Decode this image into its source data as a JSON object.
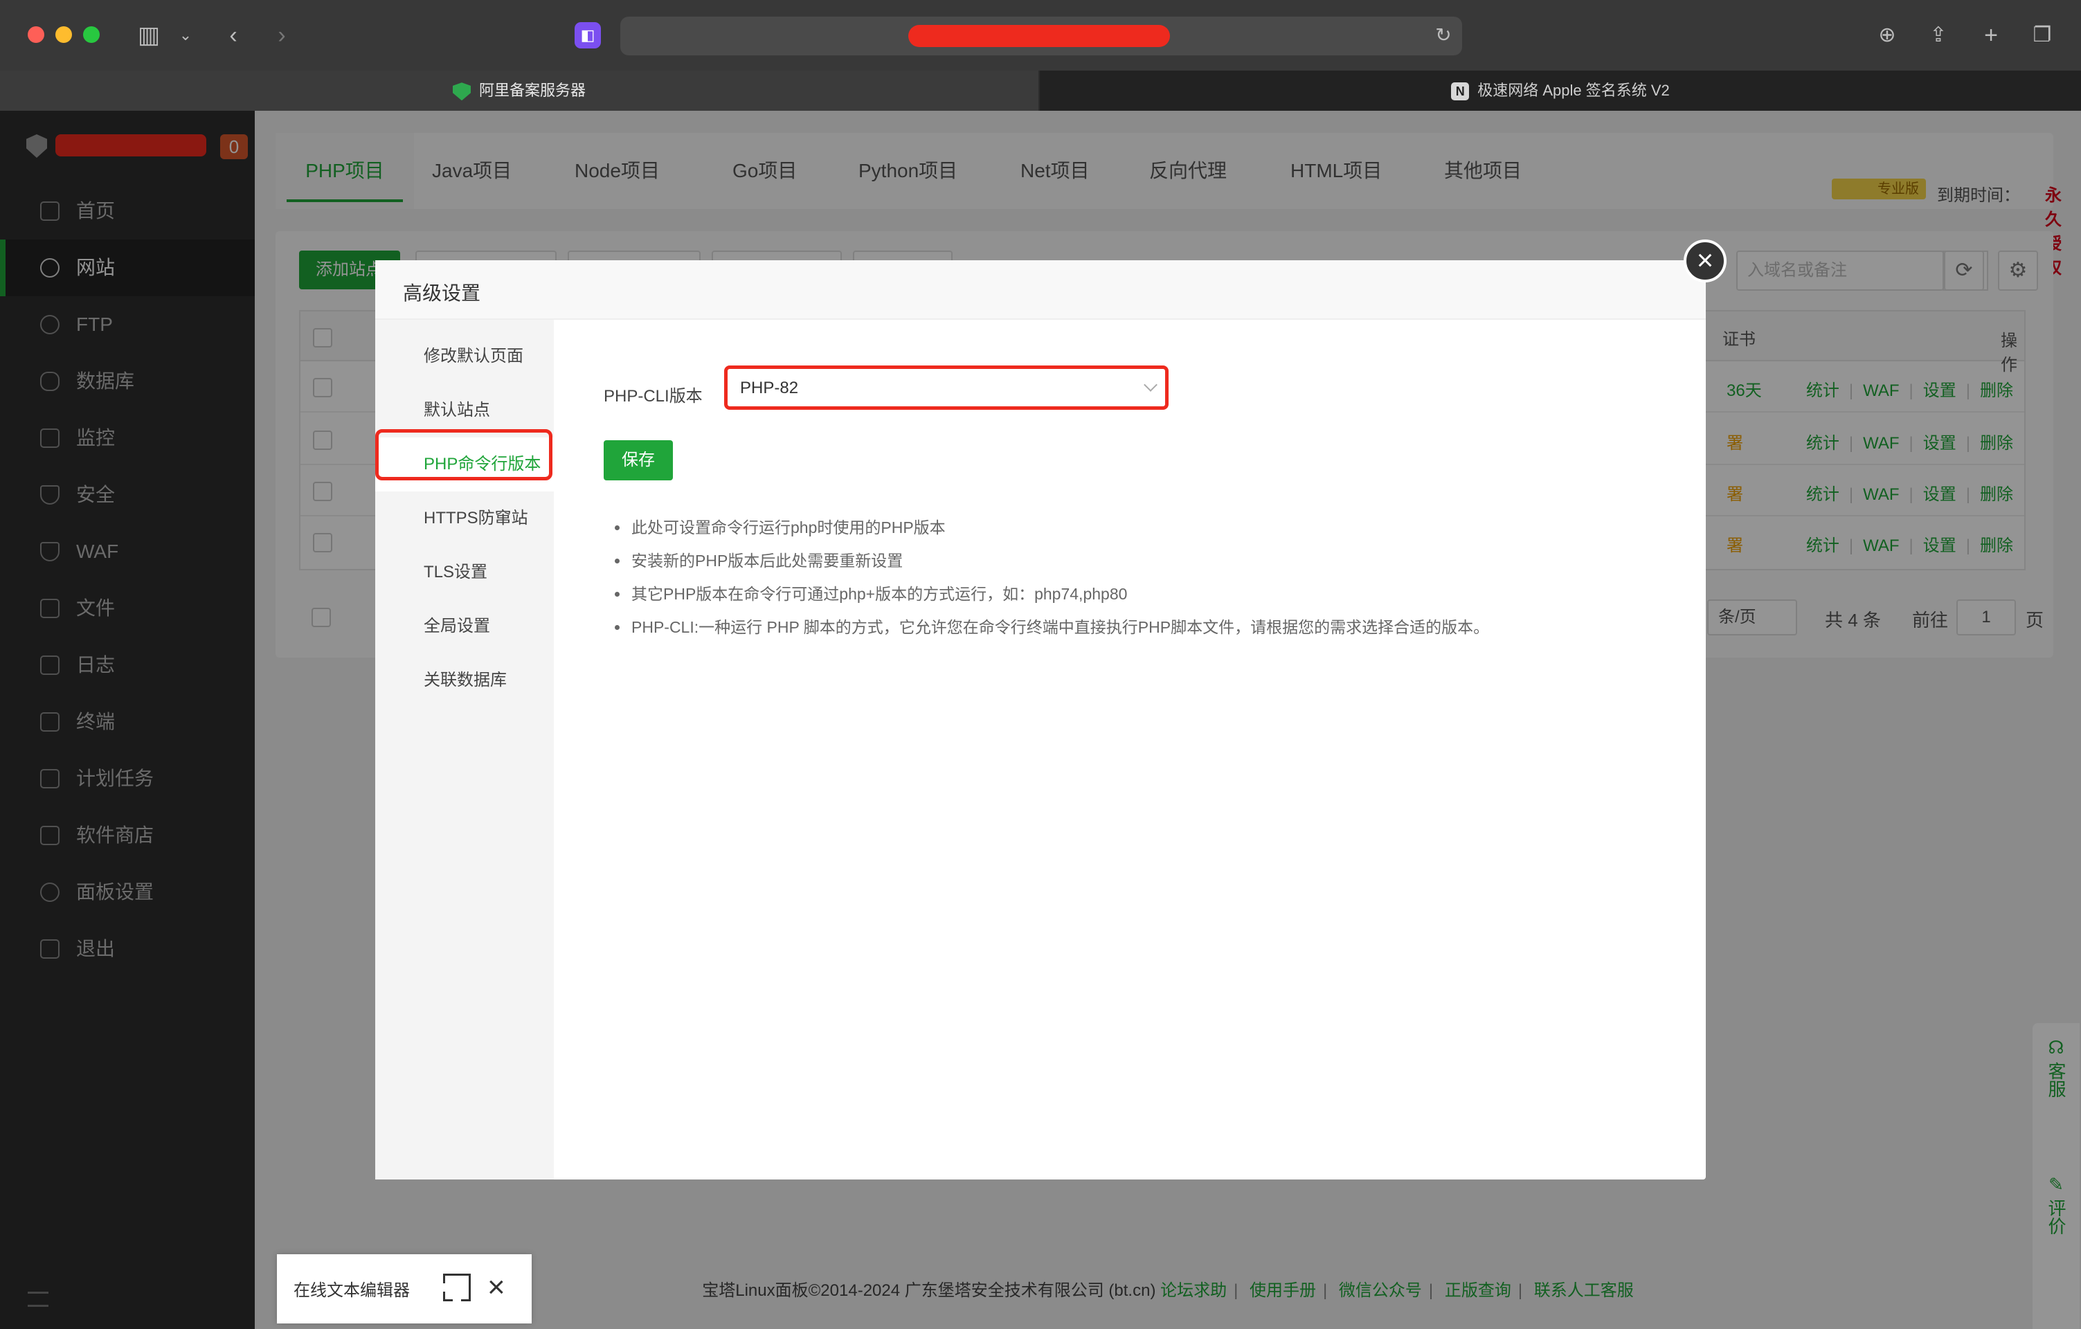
{
  "browser": {
    "tabs": [
      {
        "title": "阿里备案服务器",
        "active": true
      },
      {
        "title": "极速网络 Apple 签名系统 V2",
        "active": false,
        "favicon": "N"
      }
    ]
  },
  "sidebar": {
    "badge": "0",
    "items": [
      {
        "label": "首页",
        "icon": "home-icon"
      },
      {
        "label": "网站",
        "icon": "globe-icon",
        "active": true
      },
      {
        "label": "FTP",
        "icon": "ftp-icon"
      },
      {
        "label": "数据库",
        "icon": "database-icon"
      },
      {
        "label": "监控",
        "icon": "monitor-icon"
      },
      {
        "label": "安全",
        "icon": "shield-icon"
      },
      {
        "label": "WAF",
        "icon": "waf-icon"
      },
      {
        "label": "文件",
        "icon": "folder-icon"
      },
      {
        "label": "日志",
        "icon": "log-icon"
      },
      {
        "label": "终端",
        "icon": "terminal-icon"
      },
      {
        "label": "计划任务",
        "icon": "calendar-icon"
      },
      {
        "label": "软件商店",
        "icon": "apps-icon"
      },
      {
        "label": "面板设置",
        "icon": "gear-icon"
      },
      {
        "label": "退出",
        "icon": "logout-icon"
      }
    ]
  },
  "project_tabs": [
    "PHP项目",
    "Java项目",
    "Node项目",
    "Go项目",
    "Python项目",
    "Net项目",
    "反向代理",
    "HTML项目",
    "其他项目"
  ],
  "license": {
    "badge": "专业版",
    "expire_label": "到期时间：",
    "expire_value": "永久授权"
  },
  "toolbar": {
    "add_site": "添加站点",
    "search_placeholder": "入域名或备注"
  },
  "table": {
    "header_cert": "证书",
    "header_ops": "操作",
    "rows": [
      {
        "cert": "36天",
        "ops": [
          "统计",
          "WAF",
          "设置",
          "删除"
        ]
      },
      {
        "cert": "署",
        "ops": [
          "统计",
          "WAF",
          "设置",
          "删除"
        ]
      },
      {
        "cert": "署",
        "ops": [
          "统计",
          "WAF",
          "设置",
          "删除"
        ]
      },
      {
        "cert": "署",
        "ops": [
          "统计",
          "WAF",
          "设置",
          "删除"
        ]
      }
    ]
  },
  "pager": {
    "per_page": "条/页",
    "total": "共 4 条",
    "goto": "前往",
    "page": "1",
    "unit": "页"
  },
  "footer": {
    "copyright": "宝塔Linux面板©2014-2024 广东堡塔安全技术有限公司 (bt.cn)",
    "links": [
      "论坛求助",
      "使用手册",
      "微信公众号",
      "正版查询",
      "联系人工客服"
    ]
  },
  "float_side": {
    "service": "客服",
    "review": "评价"
  },
  "modal": {
    "title": "高级设置",
    "nav": [
      "修改默认页面",
      "默认站点",
      "PHP命令行版本",
      "HTTPS防窜站",
      "TLS设置",
      "全局设置",
      "关联数据库"
    ],
    "active_nav": 2,
    "form_label": "PHP-CLI版本",
    "select_value": "PHP-82",
    "save_label": "保存",
    "tips": [
      "此处可设置命令行运行php时使用的PHP版本",
      "安装新的PHP版本后此处需要重新设置",
      "其它PHP版本在命令行可通过php+版本的方式运行，如：php74,php80",
      "PHP-CLI:一种运行 PHP 脚本的方式，它允许您在命令行终端中直接执行PHP脚本文件，请根据您的需求选择合适的版本。"
    ]
  },
  "editor_widget": {
    "label": "在线文本编辑器"
  },
  "colors": {
    "accent": "#20a53a",
    "highlight": "#ee2a1e",
    "danger": "#d9001b"
  }
}
